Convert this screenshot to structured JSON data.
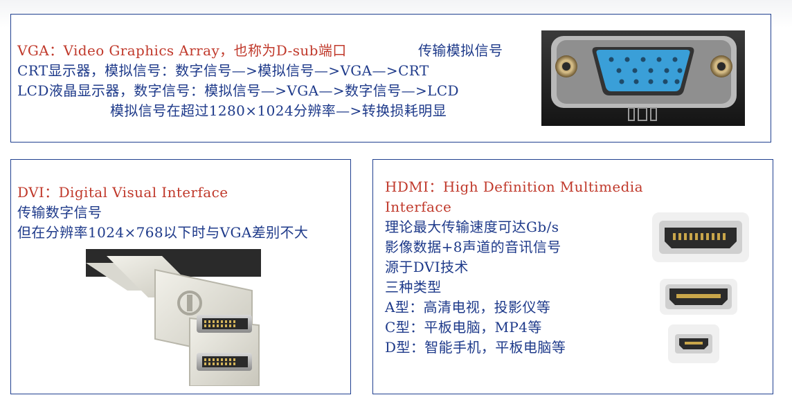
{
  "vga": {
    "title": "VGA：Video Graphics Array，也称为D-sub端口",
    "signal": "传输模拟信号",
    "lines": [
      "CRT显示器，模拟信号：数字信号—>模拟信号—>VGA—>CRT",
      "LCD液晶显示器，数字信号：模拟信号—>VGA—>数字信号—>LCD",
      "模拟信号在超过1280×1024分辨率—>转换损耗明显"
    ]
  },
  "dvi": {
    "title": "DVI：Digital Visual Interface",
    "lines": [
      "传输数字信号",
      "但在分辨率1024×768以下时与VGA差别不大"
    ]
  },
  "hdmi": {
    "title_line1": "HDMI：High Definition Multimedia",
    "title_line2": "Interface",
    "lines": [
      "理论最大传输速度可达Gb/s",
      "影像数据+8声道的音讯信号",
      "源于DVI技术",
      "三种类型",
      "A型：高清电视，投影仪等",
      "C型：平板电脑，MP4等",
      "D型：智能手机，平板电脑等"
    ]
  },
  "colors": {
    "title_red": "#c0392b",
    "text_blue": "#1e3a8a",
    "border": "#1f3f8f",
    "vga_connector_blue": "#3a9fd8"
  }
}
